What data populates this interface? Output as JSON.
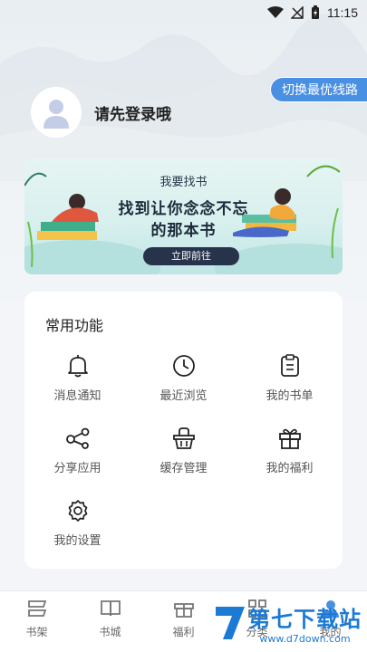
{
  "status_bar": {
    "time": "11:15"
  },
  "route_button": {
    "label": "切换最优线路"
  },
  "profile": {
    "login_prompt": "请先登录哦"
  },
  "banner": {
    "subtitle": "我要找书",
    "title_line1": "找到让你念念不忘",
    "title_line2": "的那本书",
    "button_label": "立即前往"
  },
  "functions": {
    "title": "常用功能",
    "items": [
      {
        "label": "消息通知",
        "icon": "bell-icon"
      },
      {
        "label": "最近浏览",
        "icon": "clock-icon"
      },
      {
        "label": "我的书单",
        "icon": "clipboard-icon"
      },
      {
        "label": "分享应用",
        "icon": "share-icon"
      },
      {
        "label": "缓存管理",
        "icon": "basket-icon"
      },
      {
        "label": "我的福利",
        "icon": "gift-icon"
      },
      {
        "label": "我的设置",
        "icon": "gear-icon"
      }
    ]
  },
  "tabbar": {
    "items": [
      {
        "label": "书架",
        "icon": "bookshelf-icon"
      },
      {
        "label": "书城",
        "icon": "book-icon"
      },
      {
        "label": "福利",
        "icon": "gift-icon"
      },
      {
        "label": "分类",
        "icon": "grid-icon"
      },
      {
        "label": "我的",
        "icon": "user-icon"
      }
    ]
  },
  "watermark": {
    "name": "第七下载站",
    "url": "www.d7down.com"
  },
  "colors": {
    "accent": "#4a90e2",
    "banner_button": "#26334a",
    "watermark": "#1a7ad4"
  }
}
